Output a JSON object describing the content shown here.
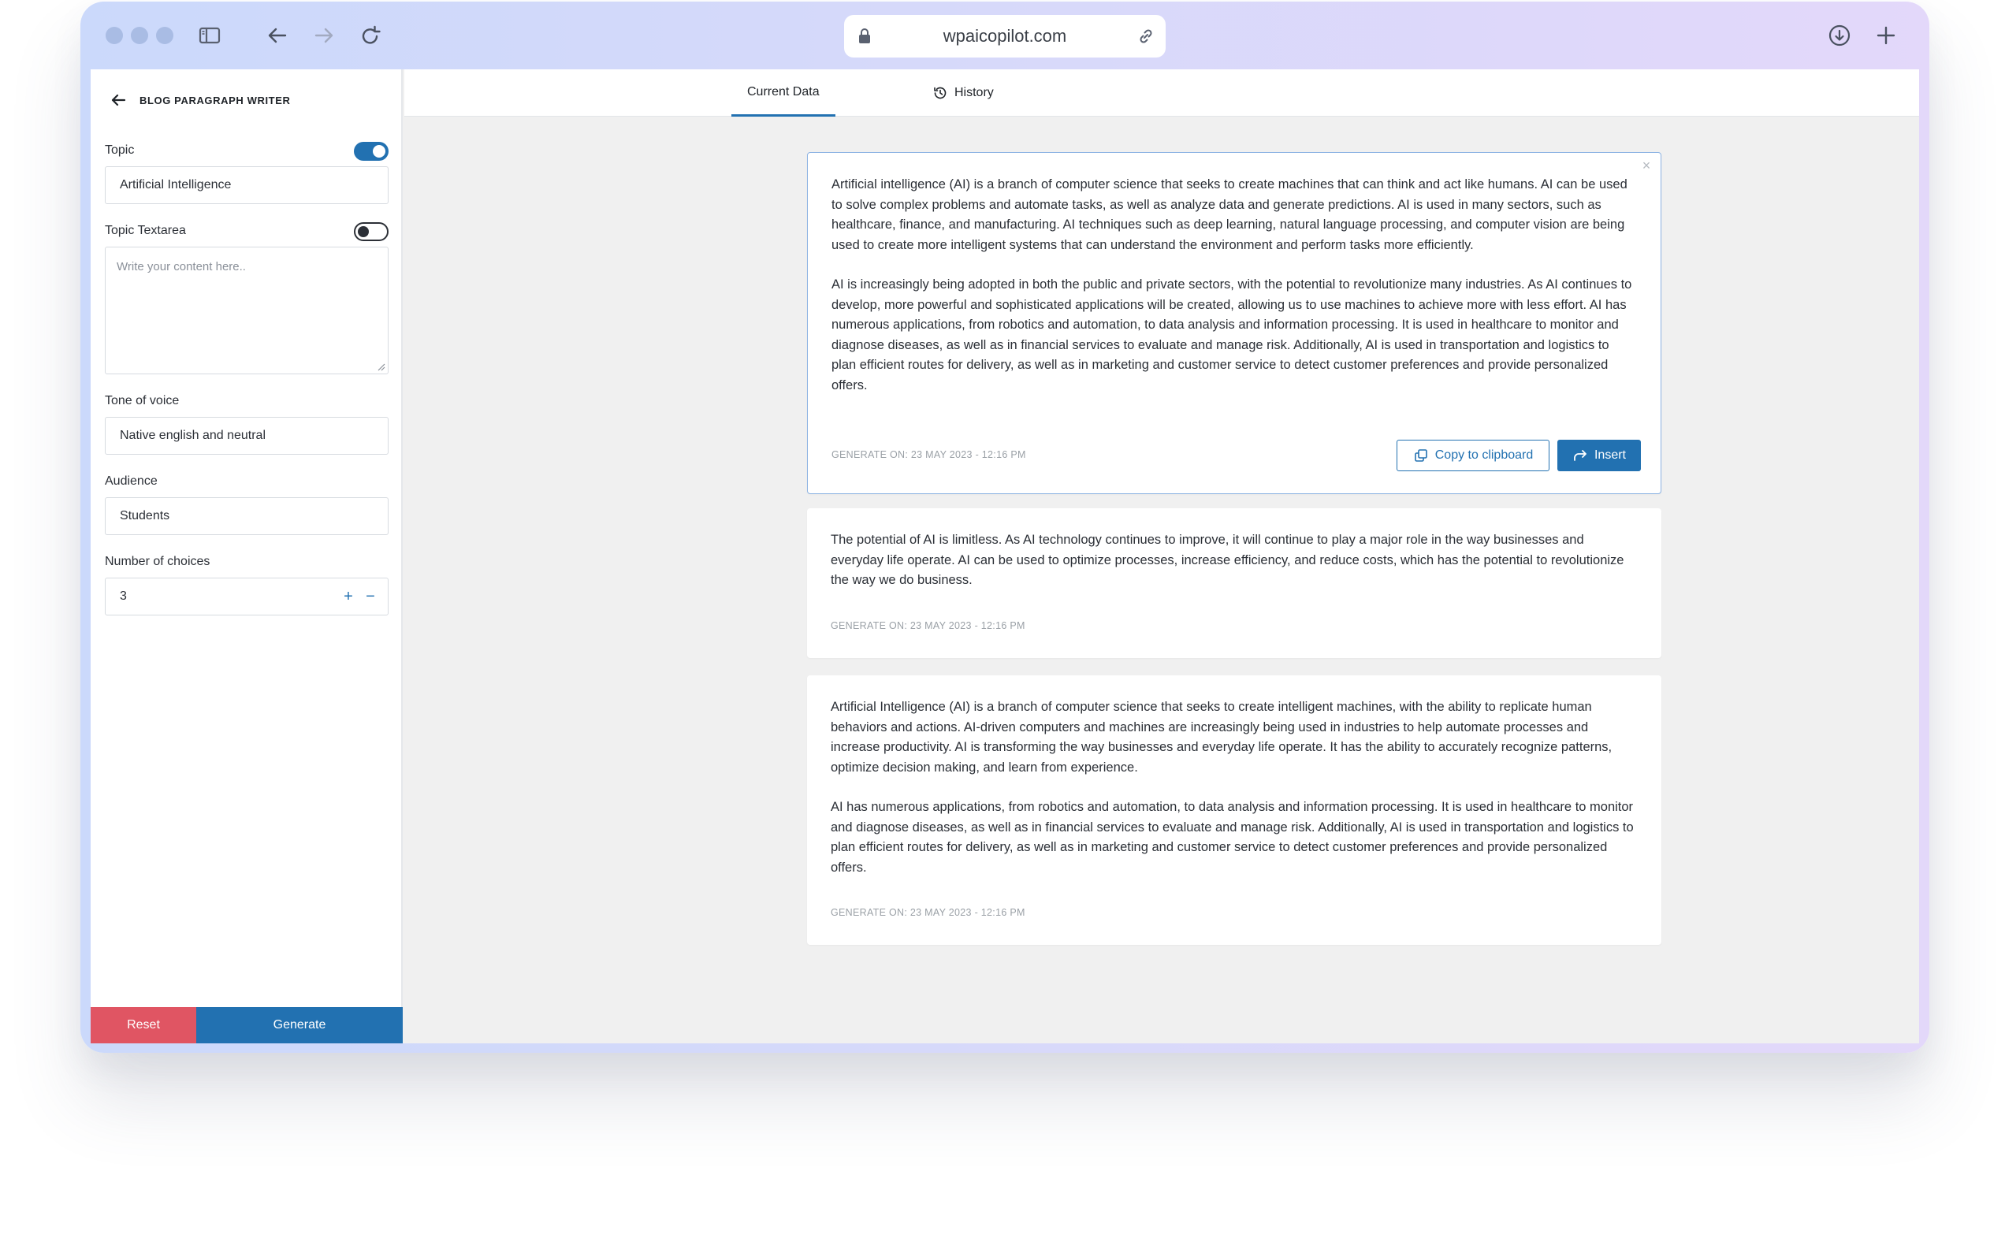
{
  "browser": {
    "url": "wpaicopilot.com"
  },
  "sidebar": {
    "title": "BLOG PARAGRAPH WRITER",
    "fields": {
      "topic": {
        "label": "Topic",
        "value": "Artificial Intelligence",
        "toggle": "on"
      },
      "topic_textarea": {
        "label": "Topic Textarea",
        "placeholder": "Write your content here..",
        "toggle": "off"
      },
      "tone": {
        "label": "Tone of voice",
        "value": "Native english and neutral"
      },
      "audience": {
        "label": "Audience",
        "value": "Students"
      },
      "choices": {
        "label": "Number of choices",
        "value": "3",
        "plus": "+",
        "minus": "−"
      }
    },
    "reset_label": "Reset",
    "generate_label": "Generate"
  },
  "tabs": [
    {
      "label": "Current Data",
      "active": true
    },
    {
      "label": "History",
      "active": false
    }
  ],
  "results": [
    {
      "paragraphs": [
        "Artificial intelligence (AI) is a branch of computer science that seeks to create machines that can think and act like humans. AI can be used to solve complex problems and automate tasks, as well as analyze data and generate predictions. AI is used in many sectors, such as healthcare, finance, and manufacturing. AI techniques such as deep learning, natural language processing, and computer vision are being used to create more intelligent systems that can understand the environment and perform tasks more efficiently.",
        "AI is increasingly being adopted in both the public and private sectors, with the potential to revolutionize many industries. As AI continues to develop, more powerful and sophisticated applications will be created, allowing us to use machines to achieve more with less effort. AI has numerous applications, from robotics and automation, to data analysis and information processing. It is used in healthcare to monitor and diagnose diseases, as well as in financial services to evaluate and manage risk. Additionally, AI is used in transportation and logistics to plan efficient routes for delivery, as well as in marketing and customer service to detect customer preferences and provide personalized offers."
      ],
      "meta": "GENERATE ON: 23 MAY 2023 - 12:16 PM",
      "copy_label": "Copy to clipboard",
      "insert_label": "Insert"
    },
    {
      "paragraphs": [
        "The potential of AI is limitless. As AI technology continues to improve, it will continue to play a major role in the way businesses and everyday life operate. AI can be used to optimize processes, increase efficiency, and reduce costs, which has the potential to revolutionize the way we do business."
      ],
      "meta": "GENERATE ON: 23 MAY 2023 - 12:16 PM"
    },
    {
      "paragraphs": [
        "Artificial Intelligence (AI) is a branch of computer science that seeks to create intelligent machines, with the ability to replicate human behaviors and actions. AI-driven computers and machines are increasingly being used in industries to help automate processes and increase productivity. AI is transforming the way businesses and everyday life operate. It has the ability to accurately recognize patterns, optimize decision making, and learn from experience.",
        "AI has numerous applications, from robotics and automation, to data analysis and information processing. It is used in healthcare to monitor and diagnose diseases, as well as in financial services to evaluate and manage risk. Additionally, AI is used in transportation and logistics to plan efficient routes for delivery, as well as in marketing and customer service to detect customer preferences and provide personalized offers."
      ],
      "meta": "GENERATE ON: 23 MAY 2023 - 12:16 PM"
    }
  ],
  "colors": {
    "accent": "#2271b1",
    "danger": "#e05563",
    "window_gradient_start": "#cbd9fb",
    "window_gradient_end": "#e3d8fa",
    "content_bg": "#f0f0f0"
  },
  "icons": {
    "traffic_lights": [
      "window-dot-icon",
      "window-dot-icon",
      "window-dot-icon"
    ],
    "toolbar": [
      "sidebar-toggle-icon",
      "back-arrow-icon",
      "forward-arrow-icon",
      "reload-icon",
      "download-icon",
      "new-tab-icon"
    ],
    "url": [
      "lock-icon",
      "link-icon"
    ],
    "sidebar": [
      "back-arrow-icon",
      "resize-grip-icon"
    ],
    "tabs": [
      "history-icon"
    ],
    "cards": [
      "close-icon",
      "copy-icon",
      "insert-arrow-icon"
    ]
  }
}
